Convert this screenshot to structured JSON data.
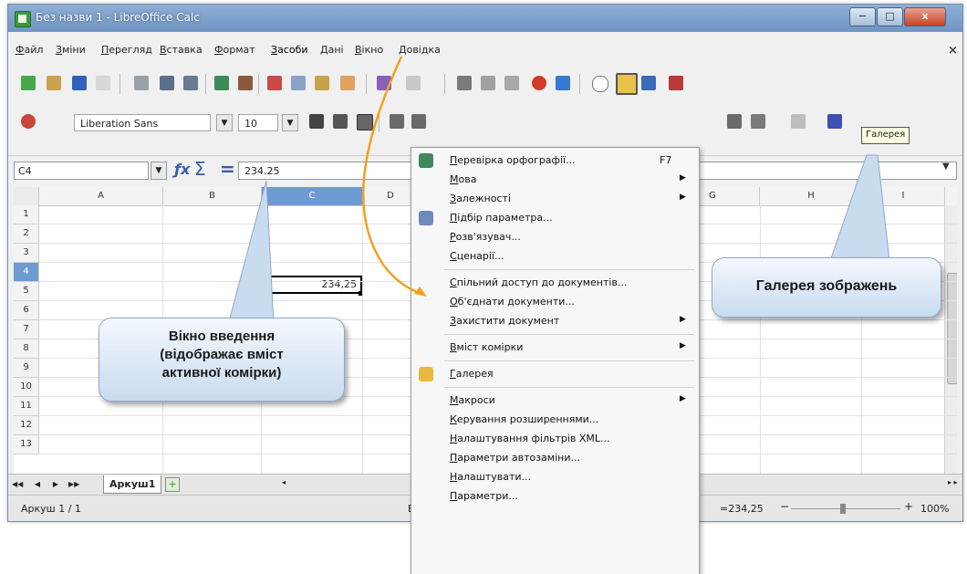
{
  "window": {
    "title": "Без назви 1 - LibreOffice Calc",
    "minimize_glyph": "−",
    "maximize_glyph": "□",
    "close_glyph": "x",
    "doc_close_glyph": "×"
  },
  "menubar": [
    "Файл",
    "Зміни",
    "Перегляд",
    "Вставка",
    "Формат",
    "Засоби",
    "Дані",
    "Вікно",
    "Довідка"
  ],
  "formatting": {
    "font_name": "Liberation Sans",
    "font_size": "10",
    "dropdown_glyph": "▼"
  },
  "tooltip": "Галерея",
  "formula_bar": {
    "name_box": "C4",
    "function_wizard": "ƒx",
    "sum": "Σ",
    "equals": "=",
    "formula": "234.25",
    "expand_glyph": "▼"
  },
  "grid": {
    "columns": [
      "A",
      "B",
      "C",
      "D",
      "G",
      "H",
      "I"
    ],
    "rows": [
      "1",
      "2",
      "3",
      "4",
      "5",
      "6",
      "7",
      "8",
      "9",
      "10",
      "11",
      "12",
      "13"
    ],
    "active_cell_value": "234,25"
  },
  "sheet_tabs": {
    "nav": [
      "◀◀",
      "◀",
      "▶",
      "▶▶"
    ],
    "sheet": "Аркуш1",
    "add": "+",
    "scroll_left": "◂",
    "scroll_right": "▸ ▸"
  },
  "statusbar": {
    "sheet": "Аркуш 1 / 1",
    "style": "Баз",
    "sum": "=234,25",
    "zoom_minus": "−",
    "zoom_plus": "+",
    "zoom": "100%",
    "zoom_fraction": 0.45
  },
  "tools_menu": [
    {
      "label": "Перевірка орфографії...",
      "shortcut": "F7",
      "icon": "spellcheck-icon",
      "submenu": false
    },
    {
      "label": "Мова",
      "shortcut": "",
      "icon": "",
      "submenu": true
    },
    {
      "label": "Залежності",
      "shortcut": "",
      "icon": "",
      "submenu": true
    },
    {
      "label": "Підбір параметра...",
      "shortcut": "",
      "icon": "goal-seek-icon",
      "submenu": false
    },
    {
      "label": "Розв'язувач...",
      "shortcut": "",
      "icon": "",
      "submenu": false
    },
    {
      "label": "Сценарії...",
      "shortcut": "",
      "icon": "",
      "submenu": false
    },
    {
      "separator": true
    },
    {
      "label": "Спільний доступ до документів...",
      "shortcut": "",
      "icon": "",
      "submenu": false
    },
    {
      "label": "Об'єднати документи...",
      "shortcut": "",
      "icon": "",
      "submenu": false
    },
    {
      "label": "Захистити документ",
      "shortcut": "",
      "icon": "",
      "submenu": true
    },
    {
      "separator": true
    },
    {
      "label": "Вміст комірки",
      "shortcut": "",
      "icon": "",
      "submenu": true
    },
    {
      "separator": true
    },
    {
      "label": "Галерея",
      "shortcut": "",
      "icon": "gallery-icon",
      "submenu": false
    },
    {
      "separator": true
    },
    {
      "label": "Макроси",
      "shortcut": "",
      "icon": "",
      "submenu": true
    },
    {
      "label": "Керування розширеннями...",
      "shortcut": "",
      "icon": "",
      "submenu": false
    },
    {
      "label": "Налаштування фільтрів XML...",
      "shortcut": "",
      "icon": "",
      "submenu": false
    },
    {
      "label": "Параметри автозаміни...",
      "shortcut": "",
      "icon": "",
      "submenu": false
    },
    {
      "label": "Налаштувати...",
      "shortcut": "",
      "icon": "",
      "submenu": false
    },
    {
      "label": "Параметри...",
      "shortcut": "",
      "icon": "",
      "submenu": false
    }
  ],
  "submenu_glyph": "▶",
  "callouts": {
    "input_line_1": "Вікно введення",
    "input_line_2": "(відображає вміст",
    "input_line_3": "активної комірки)",
    "gallery": "Галерея зображень"
  },
  "colors": {
    "accent": "#6e9bd4",
    "arrow": "#f0a020",
    "callout": "#c9dbef"
  }
}
